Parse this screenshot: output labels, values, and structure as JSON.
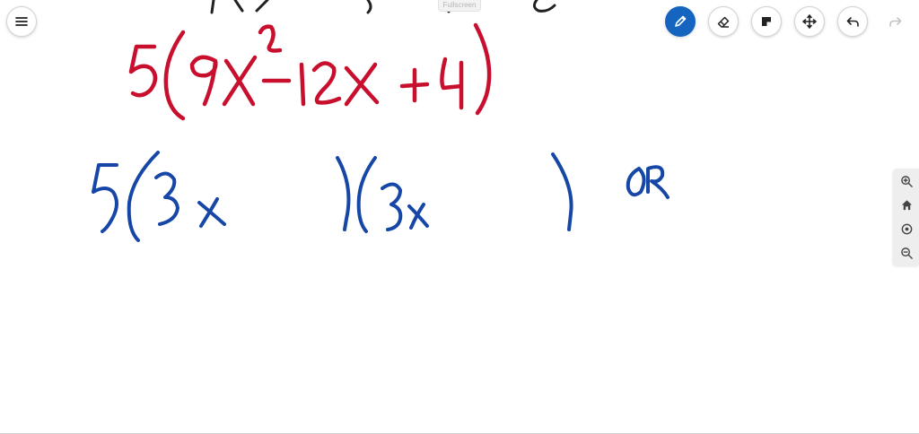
{
  "app": {
    "fullscreen_label": "Fullscreen"
  },
  "toolbar": {
    "menu_icon": "hamburger-menu-icon",
    "tools": [
      "pencil-icon",
      "eraser-icon",
      "sticky-note-icon",
      "move-icon",
      "undo-icon",
      "redo-icon"
    ],
    "active_tool": "pencil",
    "accent_color": "#1565c0"
  },
  "zoom_controls": {
    "icons": [
      "zoom-in-icon",
      "home-icon",
      "target-icon",
      "zoom-out-icon"
    ]
  },
  "ink_colors": {
    "red": "#c8102e",
    "blue": "#1747a6",
    "black": "#222222"
  }
}
